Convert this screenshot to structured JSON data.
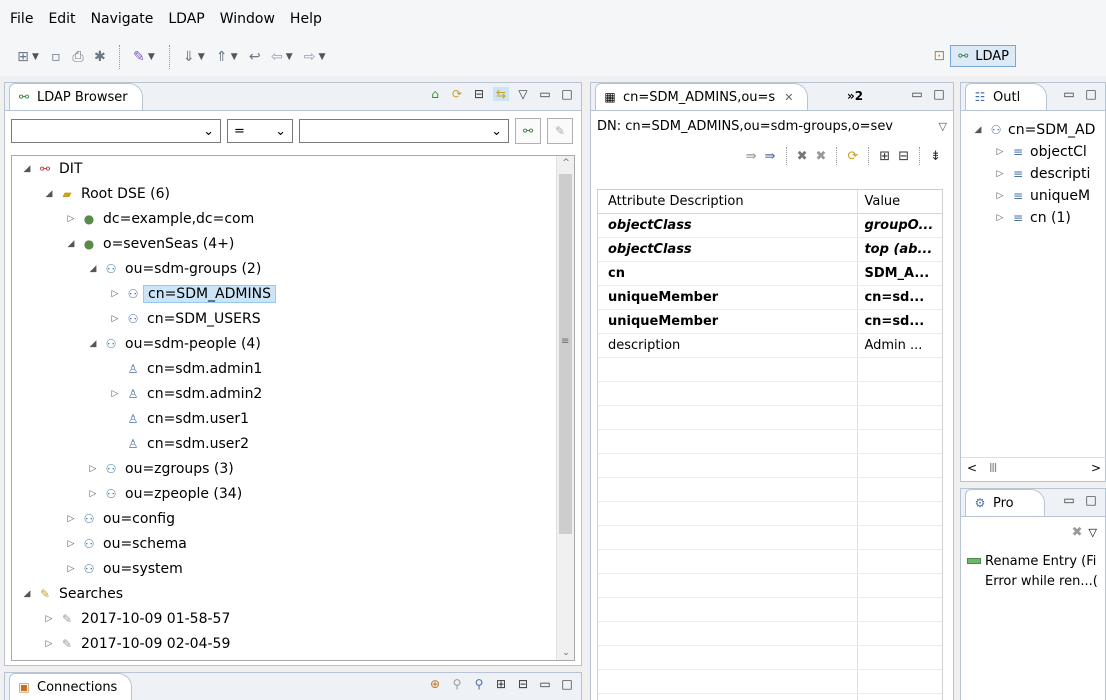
{
  "menu": [
    "File",
    "Edit",
    "Navigate",
    "LDAP",
    "Window",
    "Help"
  ],
  "perspective": {
    "label": "LDAP"
  },
  "browser": {
    "tab_title": "LDAP Browser",
    "filter_op": "=",
    "tree": [
      {
        "label": "DIT",
        "level": 0,
        "twisty": "open",
        "icon": "ldap-tree-icon"
      },
      {
        "label": "Root DSE (6)",
        "level": 1,
        "twisty": "open",
        "icon": "root-dse-icon"
      },
      {
        "label": "dc=example,dc=com",
        "level": 2,
        "twisty": "closed",
        "icon": "globe-icon"
      },
      {
        "label": "o=sevenSeas (4+)",
        "level": 2,
        "twisty": "open",
        "icon": "globe-icon"
      },
      {
        "label": "ou=sdm-groups (2)",
        "level": 3,
        "twisty": "open",
        "icon": "org-unit-icon"
      },
      {
        "label": "cn=SDM_ADMINS",
        "level": 4,
        "twisty": "closed",
        "icon": "group-icon",
        "selected": true
      },
      {
        "label": "cn=SDM_USERS",
        "level": 4,
        "twisty": "closed",
        "icon": "group-icon"
      },
      {
        "label": "ou=sdm-people (4)",
        "level": 3,
        "twisty": "open",
        "icon": "org-unit-icon"
      },
      {
        "label": "cn=sdm.admin1",
        "level": 4,
        "twisty": "none",
        "icon": "person-icon"
      },
      {
        "label": "cn=sdm.admin2",
        "level": 4,
        "twisty": "closed",
        "icon": "person-icon"
      },
      {
        "label": "cn=sdm.user1",
        "level": 4,
        "twisty": "none",
        "icon": "person-icon"
      },
      {
        "label": "cn=sdm.user2",
        "level": 4,
        "twisty": "none",
        "icon": "person-icon"
      },
      {
        "label": "ou=zgroups (3)",
        "level": 3,
        "twisty": "closed",
        "icon": "org-unit-icon"
      },
      {
        "label": "ou=zpeople (34)",
        "level": 3,
        "twisty": "closed",
        "icon": "org-unit-icon"
      },
      {
        "label": "ou=config",
        "level": 2,
        "twisty": "closed",
        "icon": "org-unit-icon"
      },
      {
        "label": "ou=schema",
        "level": 2,
        "twisty": "closed",
        "icon": "org-unit-icon"
      },
      {
        "label": "ou=system",
        "level": 2,
        "twisty": "closed",
        "icon": "org-unit-icon"
      },
      {
        "label": "Searches",
        "level": 0,
        "twisty": "open",
        "icon": "searches-icon"
      },
      {
        "label": "2017-10-09 01-58-57",
        "level": 1,
        "twisty": "closed",
        "icon": "search-icon"
      },
      {
        "label": "2017-10-09 02-04-59",
        "level": 1,
        "twisty": "closed",
        "icon": "search-icon"
      }
    ]
  },
  "connections": {
    "tab_title": "Connections"
  },
  "editor": {
    "tab_title": "cn=SDM_ADMINS,ou=s",
    "overflow_count": "»2",
    "dn": "DN: cn=SDM_ADMINS,ou=sdm-groups,o=sev",
    "columns": [
      "Attribute Description",
      "Value"
    ],
    "rows": [
      {
        "attr": "objectClass",
        "value": "groupO...",
        "style": "bi"
      },
      {
        "attr": "objectClass",
        "value": "top (ab...",
        "style": "bi"
      },
      {
        "attr": "cn",
        "value": "SDM_A...",
        "style": "b"
      },
      {
        "attr": "uniqueMember",
        "value": "cn=sd...",
        "style": "b"
      },
      {
        "attr": "uniqueMember",
        "value": "cn=sd...",
        "style": "b"
      },
      {
        "attr": "description",
        "value": "Admin ...",
        "style": ""
      }
    ]
  },
  "outline": {
    "tab_title": "Outl",
    "root": "cn=SDM_AD",
    "items": [
      "objectCl",
      "descripti",
      "uniqueM",
      "cn (1)"
    ]
  },
  "props": {
    "tab_title": "Pro",
    "line1": "Rename Entry (Fi",
    "line2": "Error while ren...("
  }
}
